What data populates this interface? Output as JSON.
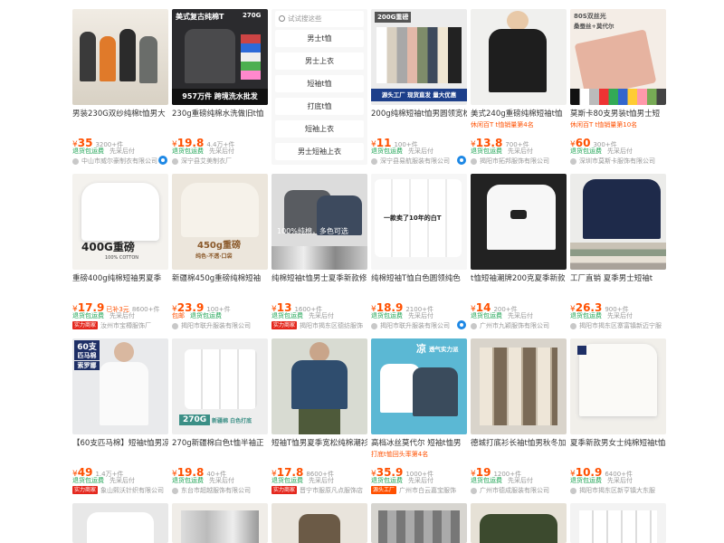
{
  "category_panel": {
    "search_placeholder": "试试搜这些",
    "items": [
      "男士t恤",
      "男士上衣",
      "短袖t恤",
      "打底t恤",
      "短袖上衣",
      "男士短袖上衣"
    ]
  },
  "products": [
    {
      "title": "男装230G双纱纯棉t恤男大",
      "price": "35",
      "sold": "3200+件",
      "tags": [
        "退货包运费",
        "先采后付"
      ],
      "shop": "中山市威尔豪制衣有限公司",
      "badge": "",
      "overlay": []
    },
    {
      "title": "230g重磅纯棉水洗做旧t恤",
      "price": "19.8",
      "sold": "4.4万+件",
      "tags": [
        "退货包运费",
        "先采后付"
      ],
      "shop": "深宁县艾美制衣厂",
      "badge": "",
      "overlay": [
        "美式复古纯棉T",
        "270G",
        "957万件 跨境洗水批发"
      ]
    },
    {
      "title": "200g纯棉短袖t恤男圆领宽松",
      "price": "11",
      "sold": "100+件",
      "tags": [
        "退货包运费",
        "先采后付"
      ],
      "shop": "深宁县易航服装有限公司",
      "badge": "",
      "overlay": [
        "200G重磅",
        "源头工厂 现货直发 量大优惠"
      ]
    },
    {
      "title": "美式240g重磅纯棉短袖t恤",
      "subtag": "休闲百T t恤销量第4名",
      "price": "13.8",
      "sold": "700+件",
      "tags": [
        "退货包运费",
        "先采后付"
      ],
      "shop": "揭阳市拓邦服饰有限公司",
      "badge": "",
      "overlay": []
    },
    {
      "title": "莫斯卡80支男装t恤男士短",
      "subtag": "休闲百T t恤销量第10名",
      "price": "60",
      "sold": "300+件",
      "tags": [
        "退货包运费",
        "先采后付"
      ],
      "shop": "深圳市莫斯卡服饰有限公司",
      "badge": "",
      "overlay": [
        "80S双丝光",
        "桑蚕丝+莫代尔"
      ]
    },
    {
      "title": "重磅400g纯棉短袖男夏季",
      "price": "17.9",
      "tr": "已补3元",
      "sold": "8600+件",
      "tags": [
        "退货包运费",
        "先采后付"
      ],
      "shop": "汝州市宝樽服饰厂",
      "badge": "实力商家",
      "overlay": [
        "400G重磅",
        "100% COTTON"
      ]
    },
    {
      "title": "新疆棉450g重磅纯棉短袖",
      "price": "23.9",
      "sold": "100+件",
      "tags": [
        "包邮",
        "退货包运费"
      ],
      "shop": "揭阳市联升服装有限公司",
      "badge": "",
      "overlay": [
        "450g重磅",
        "纯色·不透·口袋"
      ]
    },
    {
      "title": "纯棉短袖t恤男士夏季新款修身",
      "price": "13",
      "sold": "1600+件",
      "tags": [
        "退货包运费",
        "先采后付"
      ],
      "shop": "揭阳市揭东区德纺服饰",
      "badge": "实力商家",
      "overlay": [
        "100%纯棉，多色可选"
      ]
    },
    {
      "title": "纯棉短袖T恤白色圆领纯色",
      "price": "18.9",
      "sold": "2100+件",
      "tags": [
        "退货包运费",
        "先采后付"
      ],
      "shop": "揭阳市联升服装有限公司",
      "badge": "",
      "overlay": [
        "一款卖了10年的白T"
      ]
    },
    {
      "title": "t恤短袖潮牌200克夏季新款",
      "price": "14",
      "sold": "200+件",
      "tags": [
        "退货包运费",
        "先采后付"
      ],
      "shop": "广州市九颖服饰有限公司",
      "badge": "",
      "overlay": []
    },
    {
      "title": "工厂直销 夏季男士短袖t",
      "price": "26.3",
      "sold": "900+件",
      "tags": [
        "退货包运费",
        "先采后付"
      ],
      "shop": "揭阳市揭东区寨富镇新迈宁服",
      "badge": "",
      "overlay": []
    },
    {
      "title": "【60支匹马棉】短袖t恤男凉",
      "price": "49",
      "sold": "1.4万+件",
      "tags": [
        "退货包运费",
        "先采后付"
      ],
      "shop": "象山熙沃针织有限公司",
      "badge": "实力商家",
      "overlay": [
        "60支",
        "匹马棉",
        "索罗娜"
      ]
    },
    {
      "title": "270g新疆棉白色t恤半袖正",
      "price": "19.8",
      "sold": "40+件",
      "tags": [
        "退货包运费",
        "先采后付"
      ],
      "shop": "东台市超越服饰有限公司",
      "badge": "",
      "overlay": [
        "270G",
        "新疆棉 白色打底"
      ]
    },
    {
      "title": "短袖T恤男夏季宽松纯棉潮衫",
      "price": "17.8",
      "sold": "8600+件",
      "tags": [
        "退货包运费",
        "先采后付"
      ],
      "shop": "晋宁市服原凡点服饰店",
      "badge": "实力商家",
      "overlay": []
    },
    {
      "title": "高档冰丝莫代尔 短袖t恤男",
      "subtag": "打底t恤回头率第4名",
      "price": "35.9",
      "sold": "1000+件",
      "tags": [
        "退货包运费",
        "先采后付"
      ],
      "shop": "广州市白云嘉宝服饰",
      "badge": "源头工厂",
      "overlay": [
        "凉",
        "透气实力派"
      ]
    },
    {
      "title": "德城打底衫长袖t恤男秋冬加",
      "price": "19",
      "sold": "1200+件",
      "tags": [
        "退货包运费",
        "先采后付"
      ],
      "shop": "广州市德成服装有限公司",
      "badge": "",
      "overlay": []
    },
    {
      "title": "夏季新款男女士纯棉短袖t恤小",
      "price": "10.9",
      "sold": "6400+件",
      "tags": [
        "退货包运费",
        "先采后付"
      ],
      "shop": "揭阳市揭东区新亨镇大东服",
      "badge": "",
      "overlay": []
    }
  ]
}
